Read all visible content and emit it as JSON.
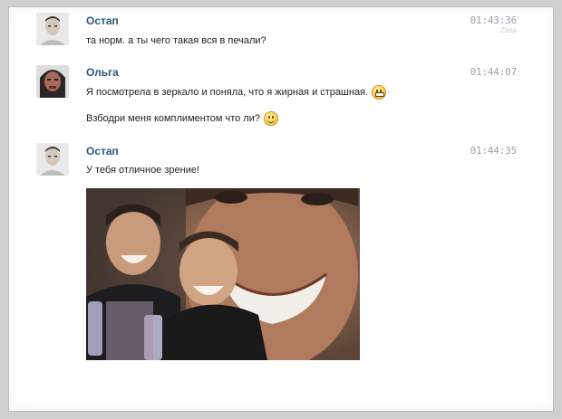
{
  "messages": [
    {
      "author": "Остап",
      "time": "01:43:36",
      "sub": "Zlata",
      "lines": [
        "та норм. а ты чего такая вся в печали?"
      ]
    },
    {
      "author": "Ольга",
      "time": "01:44:07",
      "lines": [
        "Я посмотрела в зеркало и поняла, что я жирная и страшная.",
        "Взбодри меня комплиментом что ли?"
      ],
      "emojis": [
        "grin-smiley-icon",
        "smile-smiley-icon"
      ]
    },
    {
      "author": "Остап",
      "time": "01:44:35",
      "lines": [
        "У тебя отличное зрение!"
      ],
      "attachment": "laughing-men-photo"
    }
  ],
  "colors": {
    "author": "#2b587a",
    "time": "#9aa3ad",
    "text": "#222222",
    "background": "#ffffff"
  }
}
